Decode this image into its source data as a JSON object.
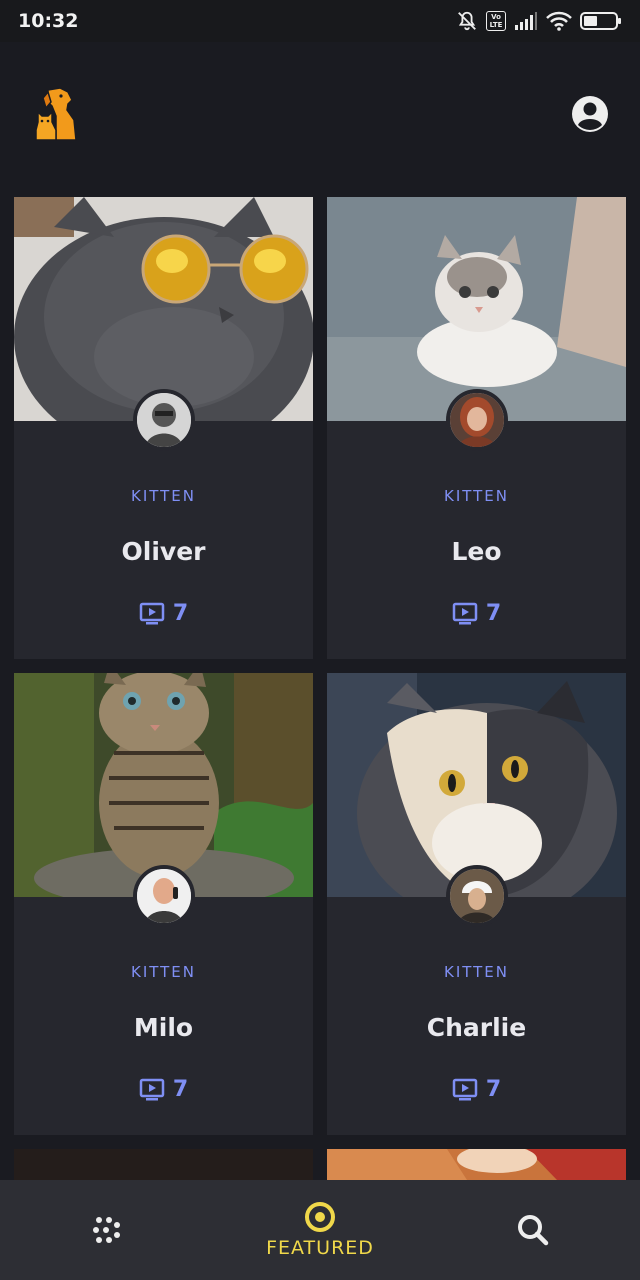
{
  "status_bar": {
    "time": "10:32",
    "icons": [
      "mute-icon",
      "volte-icon",
      "signal-icon",
      "wifi-icon",
      "battery-icon"
    ],
    "volte_text": "Vo LTE"
  },
  "app_bar": {
    "logo_icon": "pet-logo-icon",
    "account_icon": "account-icon"
  },
  "cards": [
    {
      "category": "KITTEN",
      "name": "Oliver",
      "video_count": "7"
    },
    {
      "category": "KITTEN",
      "name": "Leo",
      "video_count": "7"
    },
    {
      "category": "KITTEN",
      "name": "Milo",
      "video_count": "7"
    },
    {
      "category": "KITTEN",
      "name": "Charlie",
      "video_count": "7"
    }
  ],
  "bottom_nav": {
    "items": [
      {
        "icon": "grid-dots-icon",
        "label": ""
      },
      {
        "icon": "featured-target-icon",
        "label": "FEATURED",
        "active": true
      },
      {
        "icon": "search-icon",
        "label": ""
      }
    ]
  },
  "colors": {
    "background": "#1a1b21",
    "card": "#26272e",
    "accent_blue": "#7f8ff4",
    "accent_yellow": "#f0d84a",
    "nav_bg": "#2d2e34"
  }
}
